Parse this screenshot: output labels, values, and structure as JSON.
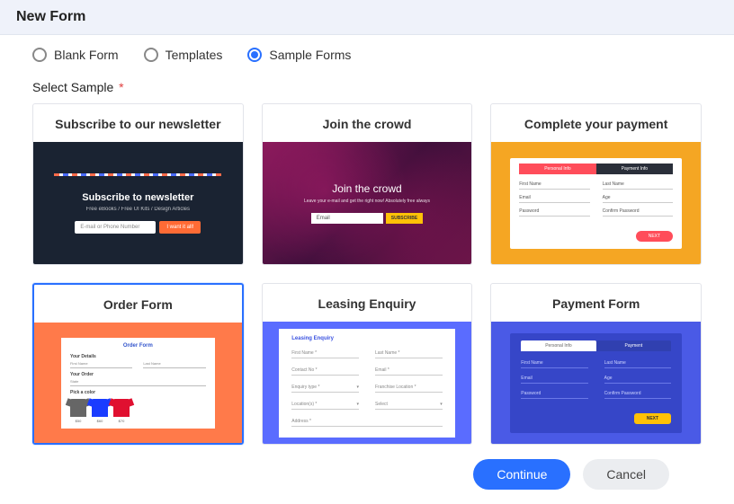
{
  "header": {
    "title": "New Form"
  },
  "radios": {
    "blank": "Blank Form",
    "templates": "Templates",
    "sample": "Sample Forms",
    "selected": "sample"
  },
  "select_label": "Select Sample",
  "required_mark": "*",
  "cards": [
    {
      "id": "newsletter",
      "title": "Subscribe to our newsletter",
      "selected": false,
      "preview": {
        "heading": "Subscribe to newsletter",
        "sub": "Free eBooks / Free UI Kits / Design Articles",
        "input": "E-mail or Phone Number",
        "button": "I want it all!"
      }
    },
    {
      "id": "crowd",
      "title": "Join the crowd",
      "selected": false,
      "preview": {
        "heading": "Join the crowd",
        "sub": "Leave your e-mail and get the right now! Absolutely free always",
        "input": "Email",
        "button": "SUBSCRIBE"
      }
    },
    {
      "id": "complete-payment",
      "title": "Complete your payment",
      "selected": false,
      "preview": {
        "tab_a": "Personal Info",
        "tab_b": "Payment Info",
        "fields": [
          "First Name",
          "Last Name",
          "Email",
          "Age",
          "Password",
          "Confirm Password"
        ],
        "next": "NEXT"
      }
    },
    {
      "id": "order-form",
      "title": "Order Form",
      "selected": true,
      "preview": {
        "heading": "Order Form",
        "section1": "Your Details",
        "f1": "First Name",
        "f2": "Last Name",
        "section2": "Your Order",
        "f3": "State",
        "section3": "Pick a color",
        "prices": [
          "$50",
          "$60",
          "$70"
        ]
      }
    },
    {
      "id": "leasing",
      "title": "Leasing Enquiry",
      "selected": false,
      "preview": {
        "heading": "Leasing Enquiry",
        "fields": [
          "First Name *",
          "Last Name *",
          "Contact No *",
          "Email *",
          "Enquiry type *",
          "Franchise Location *",
          "Location(s) *",
          "Select",
          "Address *"
        ]
      }
    },
    {
      "id": "payment-form",
      "title": "Payment Form",
      "selected": false,
      "preview": {
        "tab_a": "Personal Info",
        "tab_b": "Payment",
        "fields": [
          "First Name",
          "Last Name",
          "Email",
          "Age",
          "Password",
          "Confirm Password"
        ],
        "next": "NEXT"
      }
    }
  ],
  "footer": {
    "continue": "Continue",
    "cancel": "Cancel"
  }
}
